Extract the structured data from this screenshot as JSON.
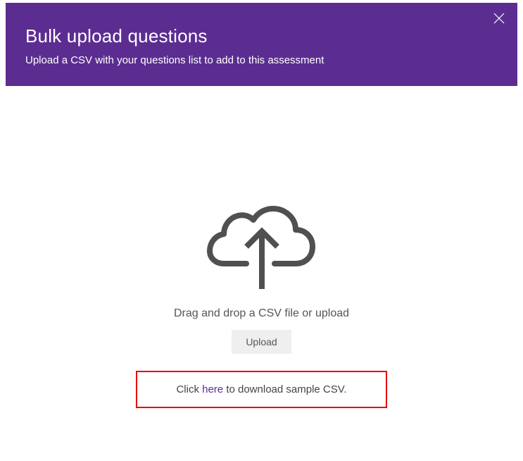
{
  "header": {
    "title": "Bulk upload questions",
    "subtitle": "Upload a CSV with your questions list to add to this assessment"
  },
  "content": {
    "instruction": "Drag and drop a CSV file or upload",
    "upload_button": "Upload",
    "download_prefix": "Click ",
    "download_link": "here",
    "download_suffix": " to download sample CSV."
  },
  "colors": {
    "accent": "#5c2d91",
    "highlight_border": "#e60000",
    "icon": "#505050"
  }
}
